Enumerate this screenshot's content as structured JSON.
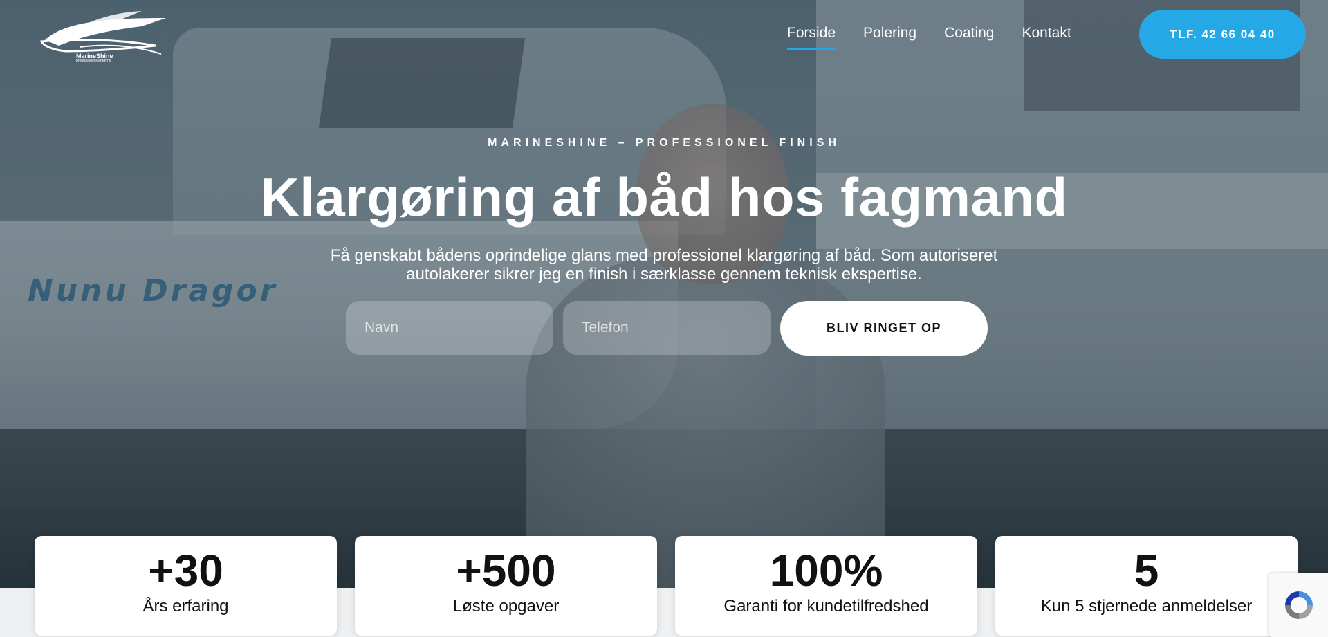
{
  "brand": {
    "name": "MarineShine",
    "tagline": "professionel klargøring"
  },
  "nav": {
    "items": [
      {
        "label": "Forside",
        "active": true
      },
      {
        "label": "Polering",
        "active": false
      },
      {
        "label": "Coating",
        "active": false
      },
      {
        "label": "Kontakt",
        "active": false
      }
    ]
  },
  "header": {
    "phone_label": "TLF. 42 66 04 40"
  },
  "hero": {
    "eyebrow": "MARINESHINE – PROFESSIONEL FINISH",
    "title": "Klargøring af båd hos fagmand",
    "lead": "Få genskabt bådens oprindelige glans med professionel klargøring af båd. Som autoriseret autolakerer sikrer jeg en finish i særklasse gennem teknisk ekspertise.",
    "boat_name": "Nunu  Dragor"
  },
  "form": {
    "name_placeholder": "Navn",
    "phone_placeholder": "Telefon",
    "submit_label": "BLIV RINGET OP"
  },
  "stats": [
    {
      "value": "+30",
      "label": "Års erfaring"
    },
    {
      "value": "+500",
      "label": "Løste opgaver"
    },
    {
      "value": "100%",
      "label": "Garanti for kundetilfredshed"
    },
    {
      "value": "5",
      "label": "Kun 5 stjernede anmeldelser"
    }
  ],
  "colors": {
    "accent": "#24a9e6",
    "text_light": "#ffffff",
    "text_dark": "#111111"
  },
  "icons": {
    "logo": "boat-logo-icon",
    "recaptcha": "recaptcha-icon"
  }
}
